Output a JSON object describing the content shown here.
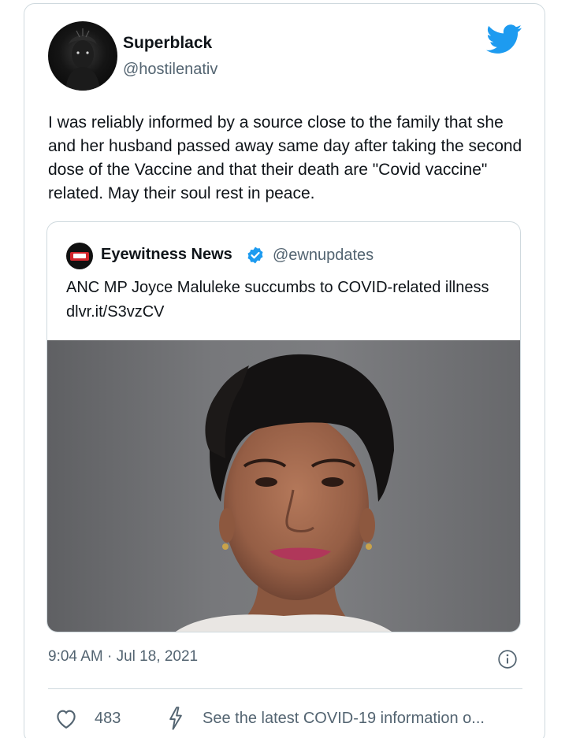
{
  "author": {
    "display_name": "Superblack",
    "handle": "@hostilenativ"
  },
  "tweet": {
    "text": "I was reliably informed by a source close to the family that she and her husband passed away same day after taking the second dose of the Vaccine and that their death are \"Covid vaccine\" related. May their soul rest in peace.",
    "timestamp": "9:04 AM · Jul 18, 2021",
    "likes": "483",
    "covid_info": "See the latest COVID-19 information o..."
  },
  "quoted_tweet": {
    "display_name": "Eyewitness News",
    "handle": "@ewnupdates",
    "text": "ANC MP Joyce Maluleke succumbs to COVID-related illness dlvr.it/S3vzCV",
    "verified": true
  },
  "icons": {
    "brand": "twitter-bird-icon",
    "verified": "verified-badge-icon",
    "info": "info-icon",
    "like": "heart-icon",
    "covid": "bolt-icon"
  },
  "colors": {
    "twitter_blue": "#1d9bf0",
    "text_primary": "#0f1419",
    "text_secondary": "#536471",
    "border": "#cfd9de",
    "ewn_red": "#d4262c"
  }
}
